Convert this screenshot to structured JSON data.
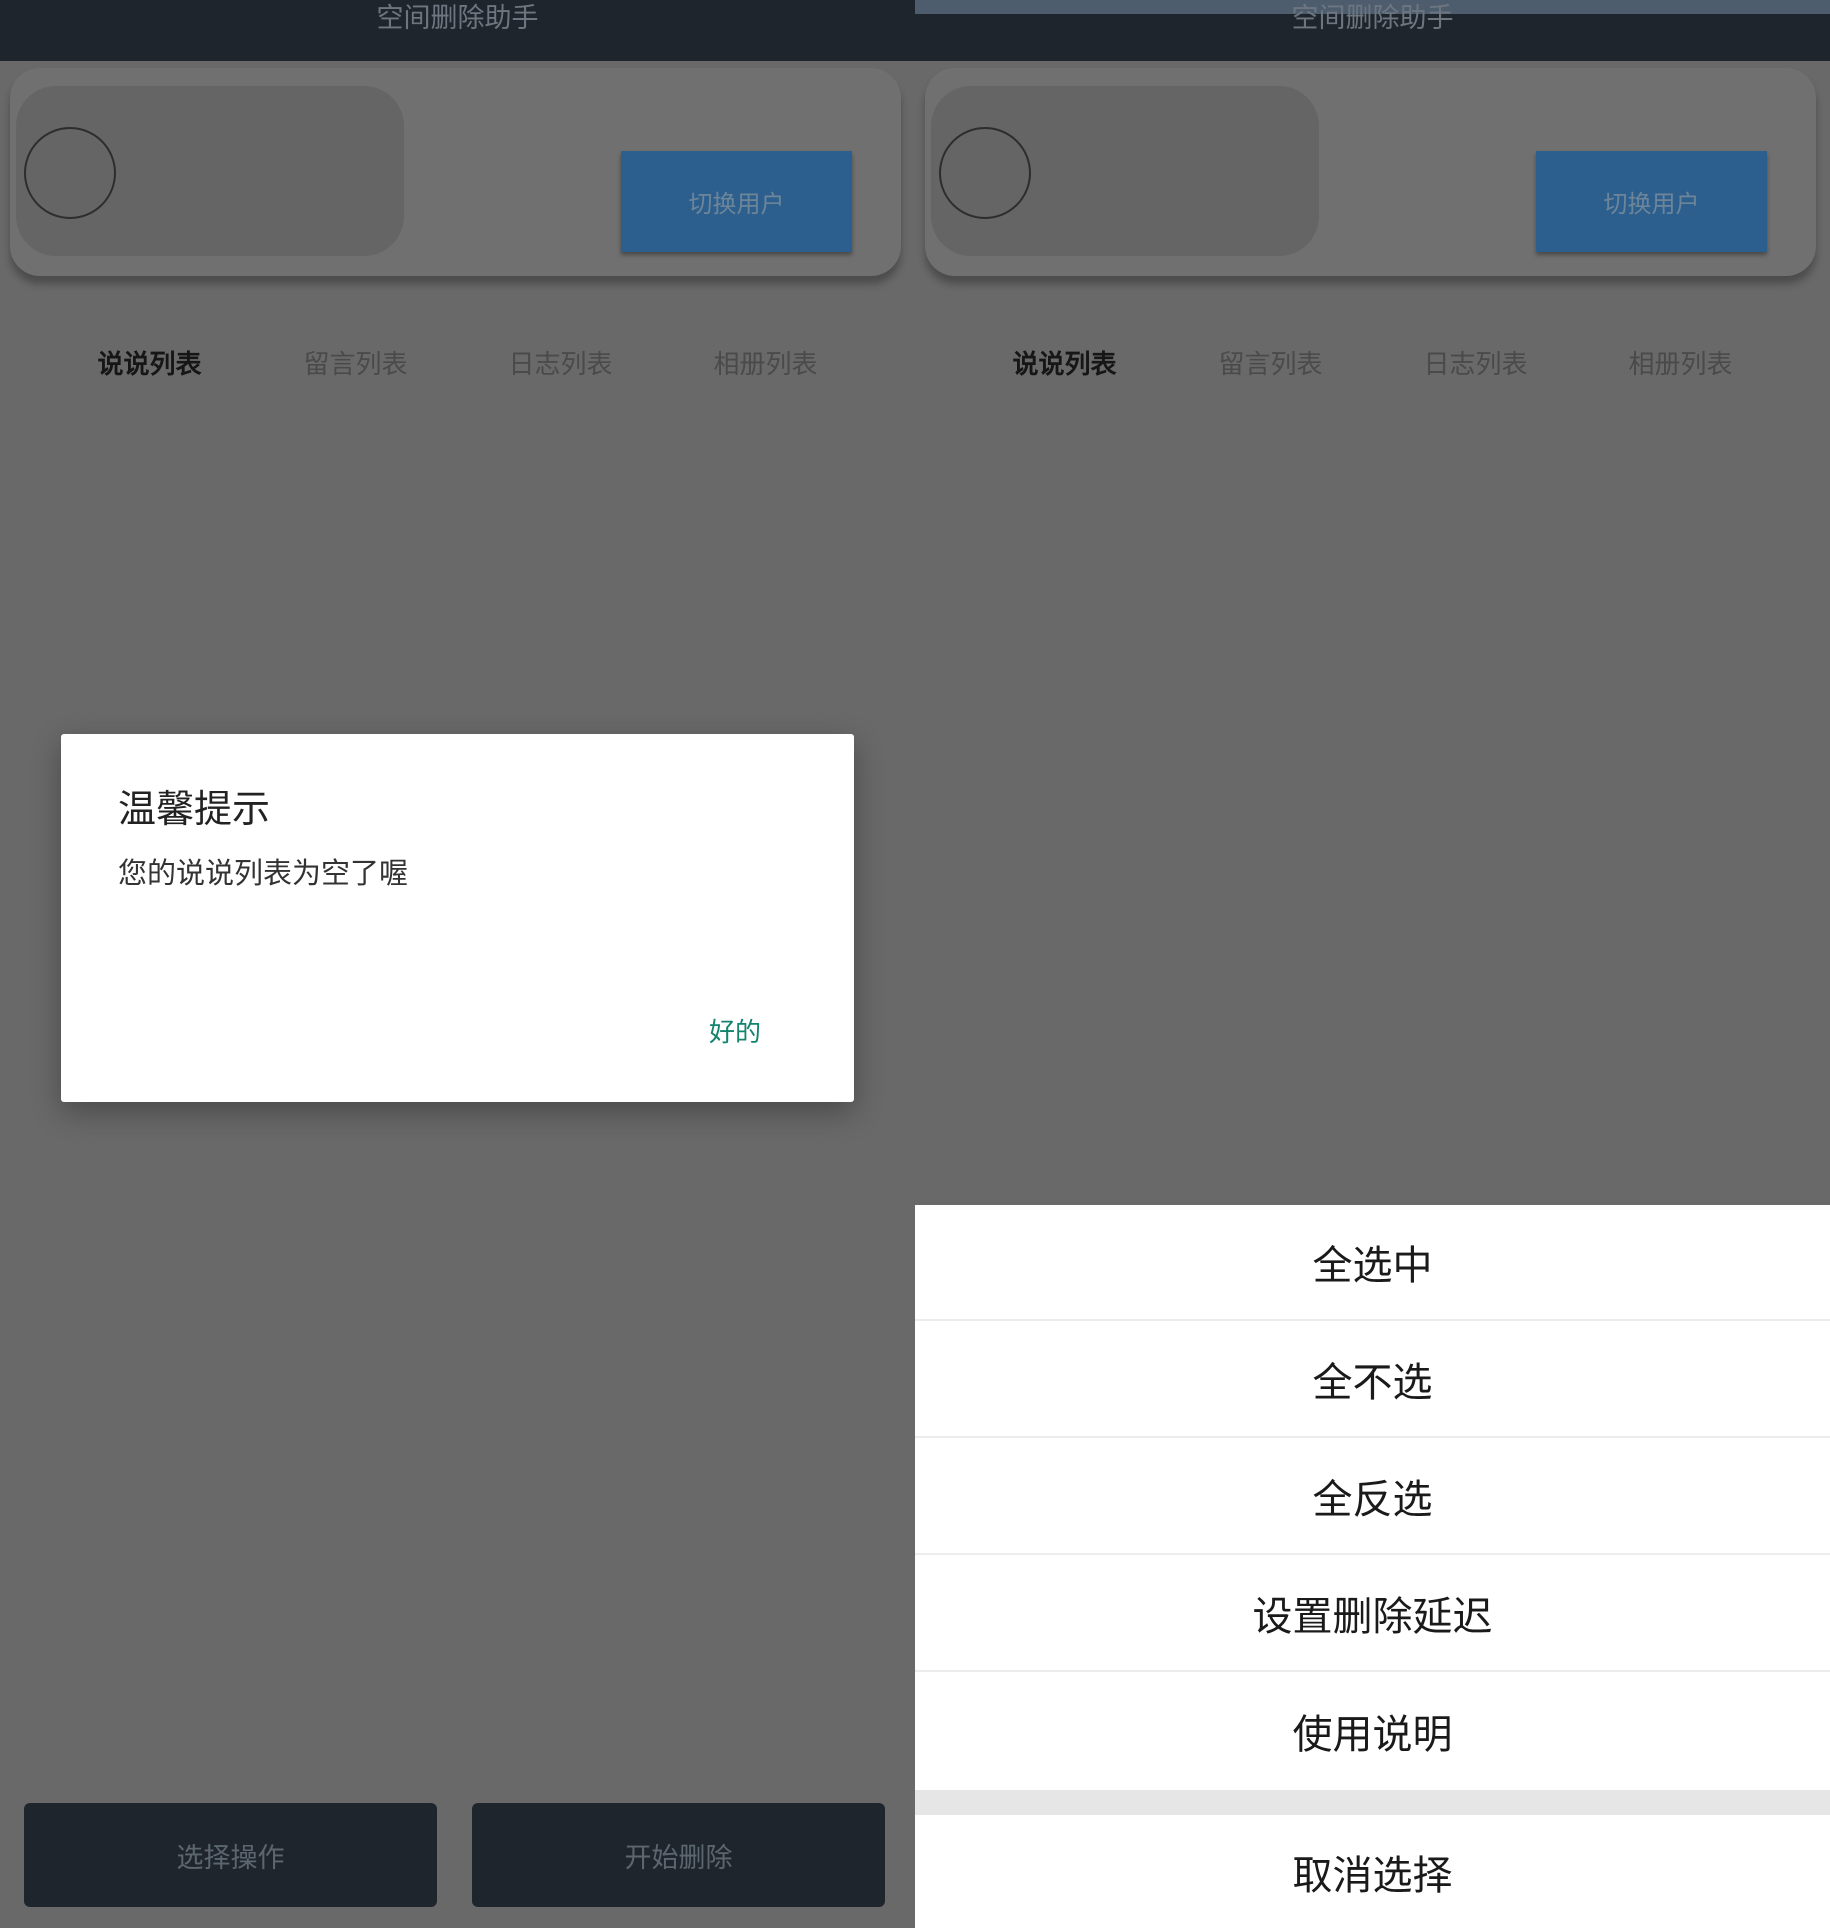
{
  "app": {
    "title": "空间删除助手"
  },
  "user_card": {
    "switch_label": "切换用户"
  },
  "tabs": [
    {
      "label": "说说列表",
      "active": true
    },
    {
      "label": "留言列表",
      "active": false
    },
    {
      "label": "日志列表",
      "active": false
    },
    {
      "label": "相册列表",
      "active": false
    }
  ],
  "bottom": {
    "select_label": "选择操作",
    "start_label": "开始删除"
  },
  "dialog": {
    "title": "温馨提示",
    "message": "您的说说列表为空了喔",
    "ok_label": "好的"
  },
  "sheet": {
    "items": [
      {
        "label": "全选中"
      },
      {
        "label": "全不选"
      },
      {
        "label": "全反选"
      },
      {
        "label": "设置删除延迟"
      },
      {
        "label": "使用说明"
      }
    ],
    "cancel_label": "取消选择"
  },
  "colors": {
    "topbar": "#1f252c",
    "switch_button": "#2d5f8e",
    "dialog_ok": "#12836d"
  }
}
